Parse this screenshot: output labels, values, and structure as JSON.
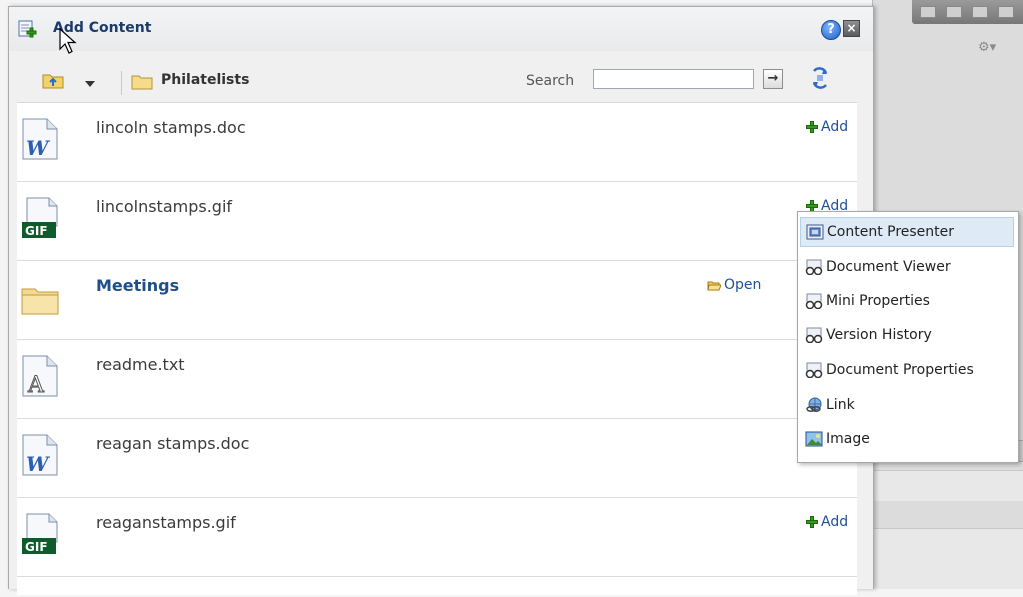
{
  "dialog": {
    "title": "Add Content",
    "help_icon": "question-icon",
    "close_icon": "close-icon"
  },
  "toolbar": {
    "breadcrumb": "Philatelists",
    "search_label": "Search",
    "search_value": "",
    "search_go": "→"
  },
  "items": [
    {
      "name": "lincoln stamps.doc",
      "type": "word-doc",
      "action": "Add"
    },
    {
      "name": "lincolnstamps.gif",
      "type": "gif",
      "action": "Add"
    },
    {
      "name": "Meetings",
      "type": "folder",
      "action": "Open"
    },
    {
      "name": "readme.txt",
      "type": "text",
      "action": ""
    },
    {
      "name": "reagan stamps.doc",
      "type": "word-doc",
      "action": ""
    },
    {
      "name": "reaganstamps.gif",
      "type": "gif",
      "action": "Add"
    }
  ],
  "menu": {
    "items": [
      {
        "label": "Content Presenter",
        "icon": "content-presenter-icon",
        "selected": true
      },
      {
        "label": "Document Viewer",
        "icon": "glasses-icon"
      },
      {
        "label": "Mini Properties",
        "icon": "glasses-icon"
      },
      {
        "label": "Version History",
        "icon": "glasses-icon"
      },
      {
        "label": "Document Properties",
        "icon": "glasses-icon"
      },
      {
        "label": "Link",
        "icon": "link-icon"
      },
      {
        "label": "Image",
        "icon": "image-icon"
      }
    ]
  },
  "colors": {
    "accent": "#1e4f9b",
    "folder_title": "#1f4e8c",
    "add_green": "#2f9c1a",
    "menu_highlight": "#dfeaf7"
  }
}
